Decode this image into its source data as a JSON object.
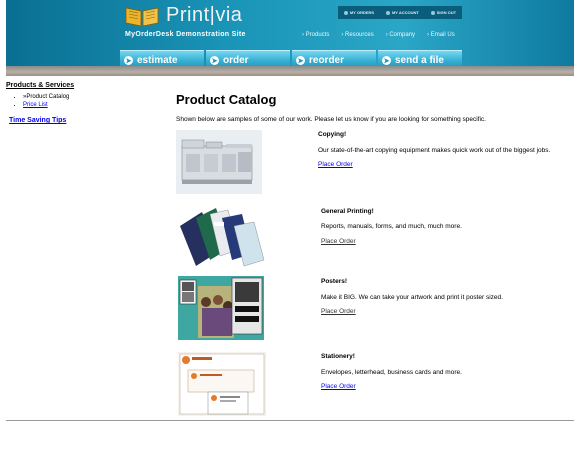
{
  "header": {
    "logo_text": "Print|via",
    "tagline": "MyOrderDesk Demonstration Site",
    "account_links": [
      "MY ORDERS",
      "MY ACCOUNT",
      "SIGN OUT"
    ],
    "top_links": [
      "› Products",
      "› Resources",
      "› Company",
      "› Email Us"
    ],
    "nav_buttons": [
      "estimate",
      "order",
      "reorder",
      "send a file"
    ]
  },
  "sidebar": {
    "section_title": "Products & Services",
    "items": [
      {
        "label": "»Product Catalog"
      },
      {
        "label": "Price List"
      }
    ],
    "tips_link": "Time Saving Tips"
  },
  "main": {
    "title": "Product Catalog",
    "intro": "Shown below are samples of some of our work. Please let us know if you are looking for something specific.",
    "products": [
      {
        "name": "Copying!",
        "description": "Our state-of-the-art copying equipment makes quick work out of the biggest jobs.",
        "link": "Place Order"
      },
      {
        "name": "General Printing!",
        "description": "Reports, manuals, forms, and much, much more.",
        "link": "Place Order"
      },
      {
        "name": "Posters!",
        "description": "Make it BIG. We can take your artwork and print it poster sized.",
        "link": "Place Order"
      },
      {
        "name": "Stationery!",
        "description": "Envelopes, letterhead, business cards and more.",
        "link": "Place Order"
      }
    ]
  },
  "colors": {
    "header_blue": "#1a95b8",
    "nav_button": "#36b1d3",
    "link": "#0000ee"
  }
}
